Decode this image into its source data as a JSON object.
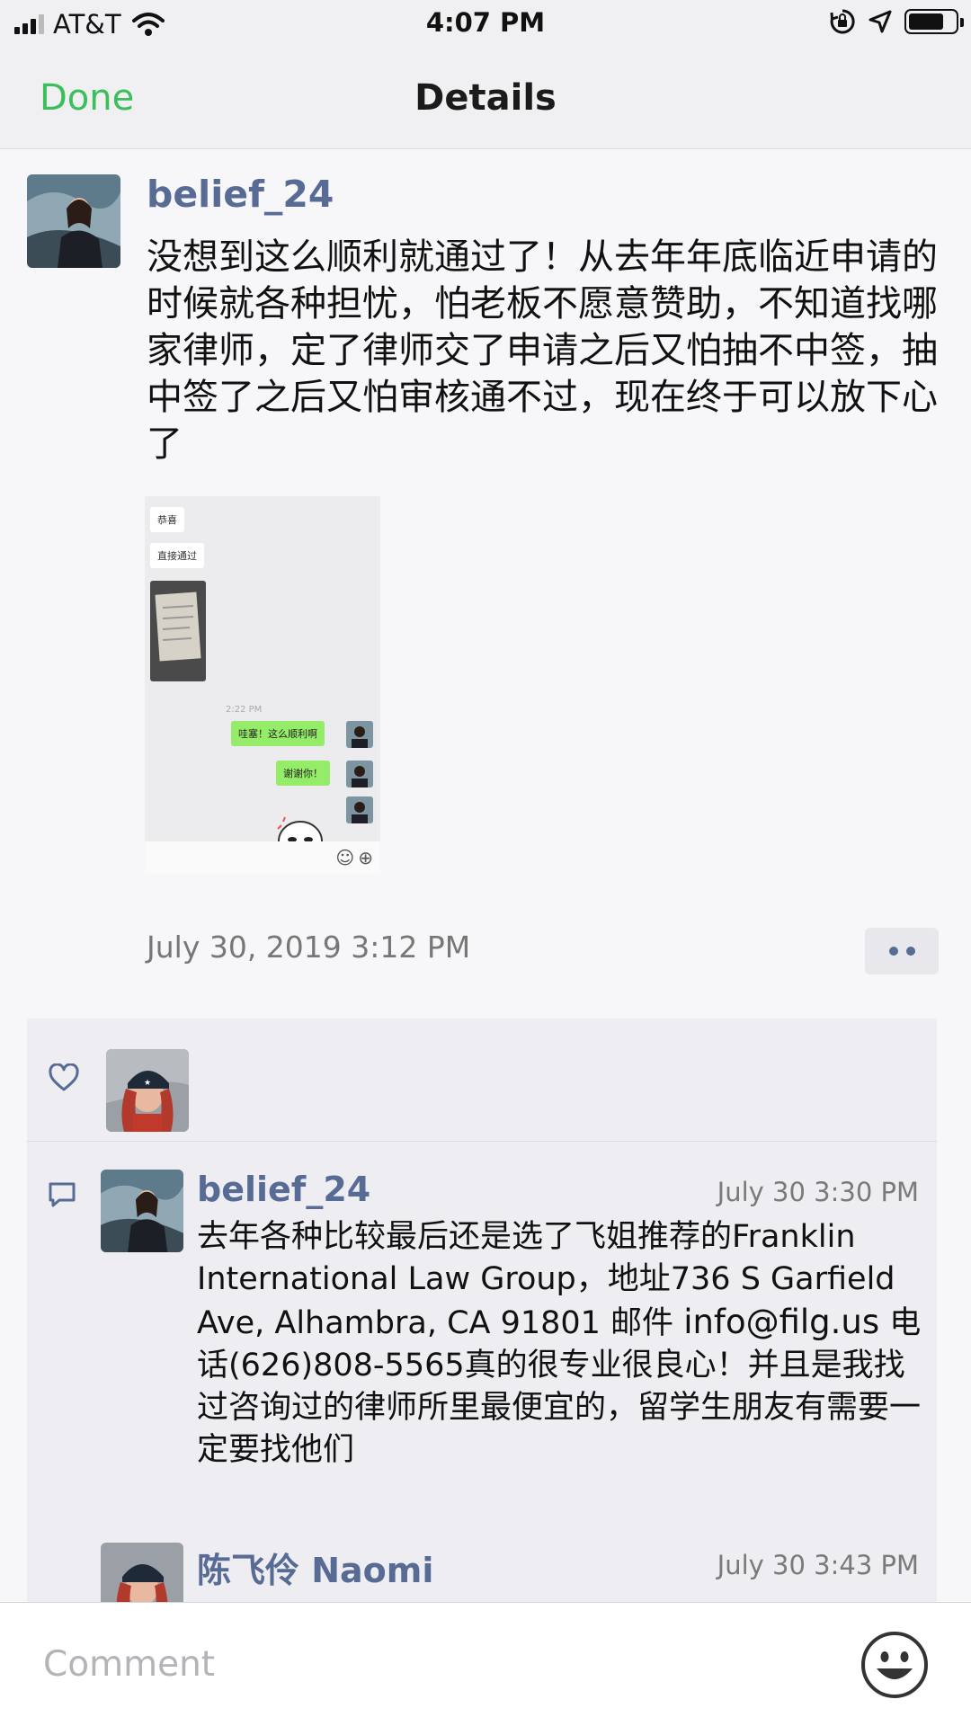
{
  "status_bar": {
    "carrier": "AT&T",
    "time": "4:07 PM",
    "battery_level": 0.75
  },
  "nav": {
    "done_label": "Done",
    "title": "Details"
  },
  "post": {
    "author": "belief_24",
    "text": "没想到这么顺利就通过了！从去年年底临近申请的时候就各种担忧，怕老板不愿意赞助，不知道找哪家律师，定了律师交了申请之后又怕抽不中签，抽中签了之后又怕审核通不过，现在终于可以放下心了",
    "image": {
      "chip_1": "恭喜",
      "chip_2": "直接通过",
      "time": "2:22 PM",
      "bubble_1": "哇塞！这么顺利啊",
      "bubble_2": "谢谢你！"
    },
    "timestamp": "July 30, 2019 3:12 PM"
  },
  "likes": {
    "icon": "heart-icon",
    "count": 1
  },
  "comments": [
    {
      "author": "belief_24",
      "time": "July 30 3:30 PM",
      "text_a": "去年各种比较最后还是选了飞姐推荐的Franklin International Law Group，地址736 S Garfield Ave, Alhambra, CA 91801 邮件",
      "email": "info@filg.us",
      "text_b": "电话(626)808-5565真的很专业很良心！并且是我找过咨询过的律师所里最便宜的，留学生朋友有需要一定要找他们"
    },
    {
      "author": "陈飞伶 Naomi",
      "time": "July 30 3:43 PM"
    }
  ],
  "comment_bar": {
    "placeholder": "Comment",
    "emoji_icon": "smiley-icon"
  },
  "colors": {
    "accent_green": "#3bbf5a",
    "name_blue": "#576b95",
    "wechat_bubble": "#95ec69"
  }
}
